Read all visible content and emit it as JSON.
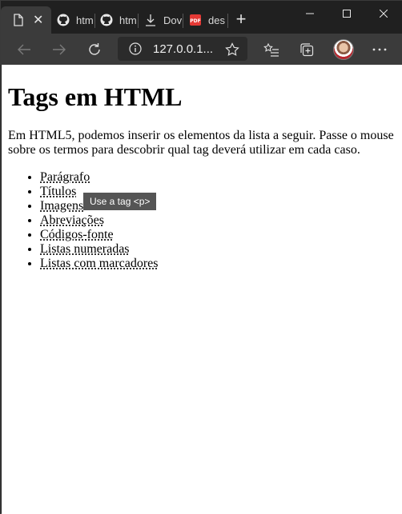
{
  "browser": {
    "tabs": [
      {
        "icon": "page-icon",
        "label": ""
      },
      {
        "icon": "github-icon",
        "label": "htm"
      },
      {
        "icon": "github-icon",
        "label": "htm"
      },
      {
        "icon": "download-icon",
        "label": "Dov"
      },
      {
        "icon": "pdf-icon",
        "label": "des"
      }
    ],
    "address": "127.0.0.1..."
  },
  "page": {
    "title": "Tags em HTML",
    "intro": "Em HTML5, podemos inserir os elementos da lista a seguir. Passe o mouse sobre os termos para descobrir qual tag deverá utilizar em cada caso.",
    "items": [
      "Parágrafo",
      "Títulos",
      "Imagens",
      "Abreviações",
      "Códigos-fonte",
      "Listas numeradas",
      "Listas com marcadores"
    ],
    "tooltip": "Use a tag <p>"
  }
}
